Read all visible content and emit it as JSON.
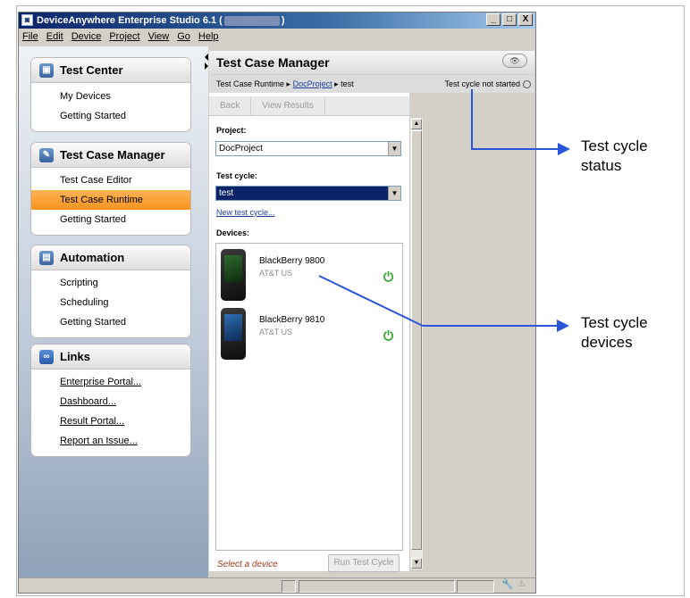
{
  "window": {
    "title_prefix": "DeviceAnywhere Enterprise Studio 6.1 (",
    "title_suffix": ")",
    "buttons": {
      "minimize": "_",
      "maximize": "□",
      "close": "X"
    }
  },
  "menu": [
    "File",
    "Edit",
    "Device",
    "Project",
    "View",
    "Go",
    "Help"
  ],
  "sidebar": {
    "test_center": {
      "title": "Test Center",
      "items": [
        "My Devices",
        "Getting Started"
      ]
    },
    "test_case_manager": {
      "title": "Test Case Manager",
      "items": [
        "Test Case Editor",
        "Test Case Runtime",
        "Getting Started"
      ],
      "active_index": 1
    },
    "automation": {
      "title": "Automation",
      "items": [
        "Scripting",
        "Scheduling",
        "Getting Started"
      ]
    },
    "links": {
      "title": "Links",
      "items": [
        "Enterprise Portal...",
        "Dashboard...",
        "Result Portal...",
        "Report an Issue..."
      ]
    }
  },
  "main": {
    "header": "Test Case Manager",
    "breadcrumb": {
      "root": "Test Case Runtime",
      "project": "DocProject",
      "current": "test"
    },
    "status": "Test cycle not started",
    "toolbar": {
      "back": "Back",
      "view_results": "View Results"
    },
    "project_label": "Project:",
    "project_value": "DocProject",
    "cycle_label": "Test cycle:",
    "cycle_value": "test",
    "new_cycle_link": "New test cycle...",
    "devices_label": "Devices:",
    "devices": [
      {
        "name": "BlackBerry 9800",
        "carrier": "AT&T US"
      },
      {
        "name": "BlackBerry 9810",
        "carrier": "AT&T US"
      }
    ],
    "select_hint": "Select a device",
    "run_button": "Run Test Cycle"
  },
  "annotations": {
    "status_1": "Test cycle",
    "status_2": "status",
    "devices_1": "Test cycle",
    "devices_2": "devices"
  },
  "colors": {
    "accent_orange": "#f7931e",
    "annotation_blue": "#2a55d6",
    "power_green": "#2aa32a"
  }
}
